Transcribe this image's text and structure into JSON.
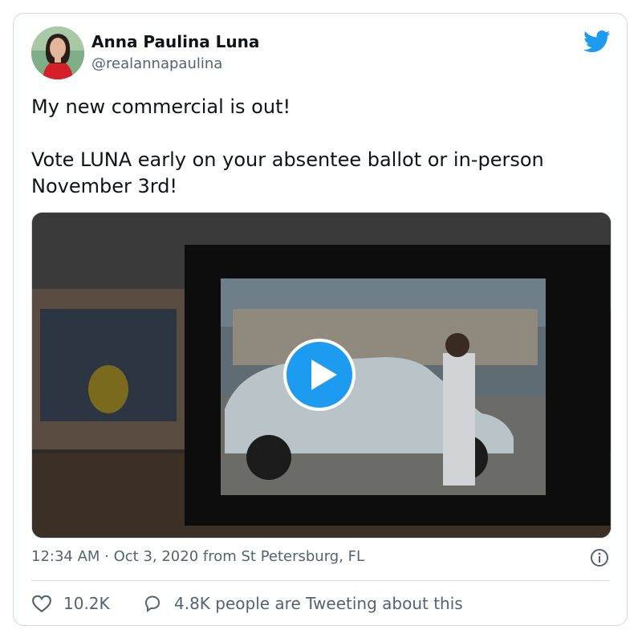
{
  "tweet": {
    "author_name": "Anna Paulina Luna",
    "author_handle": "@realannapaulina",
    "text": "My new commercial is out!\n\nVote LUNA early on your absentee ballot or in-person November 3rd!",
    "timestamp_line": "12:34 AM · Oct 3, 2020 from St Petersburg, FL",
    "likes": "10.2K",
    "conversation": "4.8K people are Tweeting about this",
    "brand_color": "#1d9bf0"
  },
  "icons": {
    "brand": "twitter-bird-icon",
    "media": "play-icon",
    "meta": "info-icon",
    "like": "heart-icon",
    "reply": "speech-bubble-icon"
  }
}
